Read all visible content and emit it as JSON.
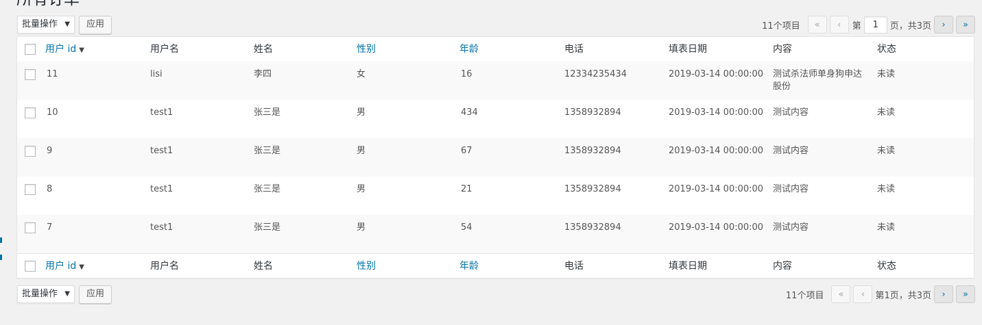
{
  "page": {
    "title": "所有订单"
  },
  "nav_top": {
    "bulk_label": "批量操作",
    "apply_label": "应用",
    "count": "11个项目",
    "first": "«",
    "prev": "‹",
    "page_prefix": "第",
    "page_value": "1",
    "page_suffix": "页，共3页",
    "next": "›",
    "last": "»"
  },
  "nav_bottom": {
    "bulk_label": "批量操作",
    "apply_label": "应用",
    "count": "11个项目",
    "first": "«",
    "prev": "‹",
    "page_text": "第1页，共3页",
    "next": "›",
    "last": "»"
  },
  "table": {
    "columns": {
      "id": "用户 id",
      "username": "用户名",
      "name": "姓名",
      "gender": "性别",
      "age": "年龄",
      "phone": "电话",
      "date": "填表日期",
      "content": "内容",
      "status": "状态"
    },
    "rows": [
      {
        "id": "11",
        "username": "lisi",
        "name": "李四",
        "gender": "女",
        "age": "16",
        "phone": "12334235434",
        "date": "2019-03-14 00:00:00",
        "content": "测试杀法师单身狗申达股份",
        "status": "未读"
      },
      {
        "id": "10",
        "username": "test1",
        "name": "张三是",
        "gender": "男",
        "age": "434",
        "phone": "1358932894",
        "date": "2019-03-14 00:00:00",
        "content": "测试内容",
        "status": "未读"
      },
      {
        "id": "9",
        "username": "test1",
        "name": "张三是",
        "gender": "男",
        "age": "67",
        "phone": "1358932894",
        "date": "2019-03-14 00:00:00",
        "content": "测试内容",
        "status": "未读"
      },
      {
        "id": "8",
        "username": "test1",
        "name": "张三是",
        "gender": "男",
        "age": "21",
        "phone": "1358932894",
        "date": "2019-03-14 00:00:00",
        "content": "测试内容",
        "status": "未读"
      },
      {
        "id": "7",
        "username": "test1",
        "name": "张三是",
        "gender": "男",
        "age": "54",
        "phone": "1358932894",
        "date": "2019-03-14 00:00:00",
        "content": "测试内容",
        "status": "未读"
      }
    ]
  },
  "colors": {
    "link": "#0073aa",
    "text": "#555555",
    "background": "#f1f1f1"
  },
  "icons": {
    "sort": "triangle-down-icon",
    "select": "caret-down-icon"
  }
}
